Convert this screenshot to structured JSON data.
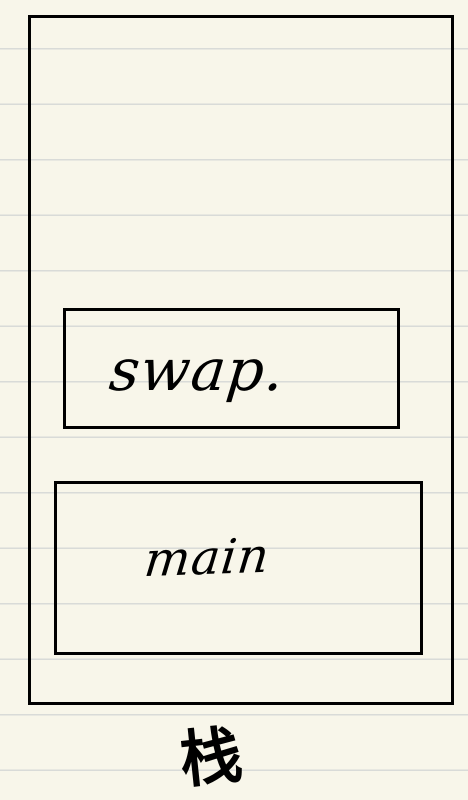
{
  "diagram": {
    "swap_label": "swap.",
    "main_label": "main",
    "stack_label": "栈"
  }
}
